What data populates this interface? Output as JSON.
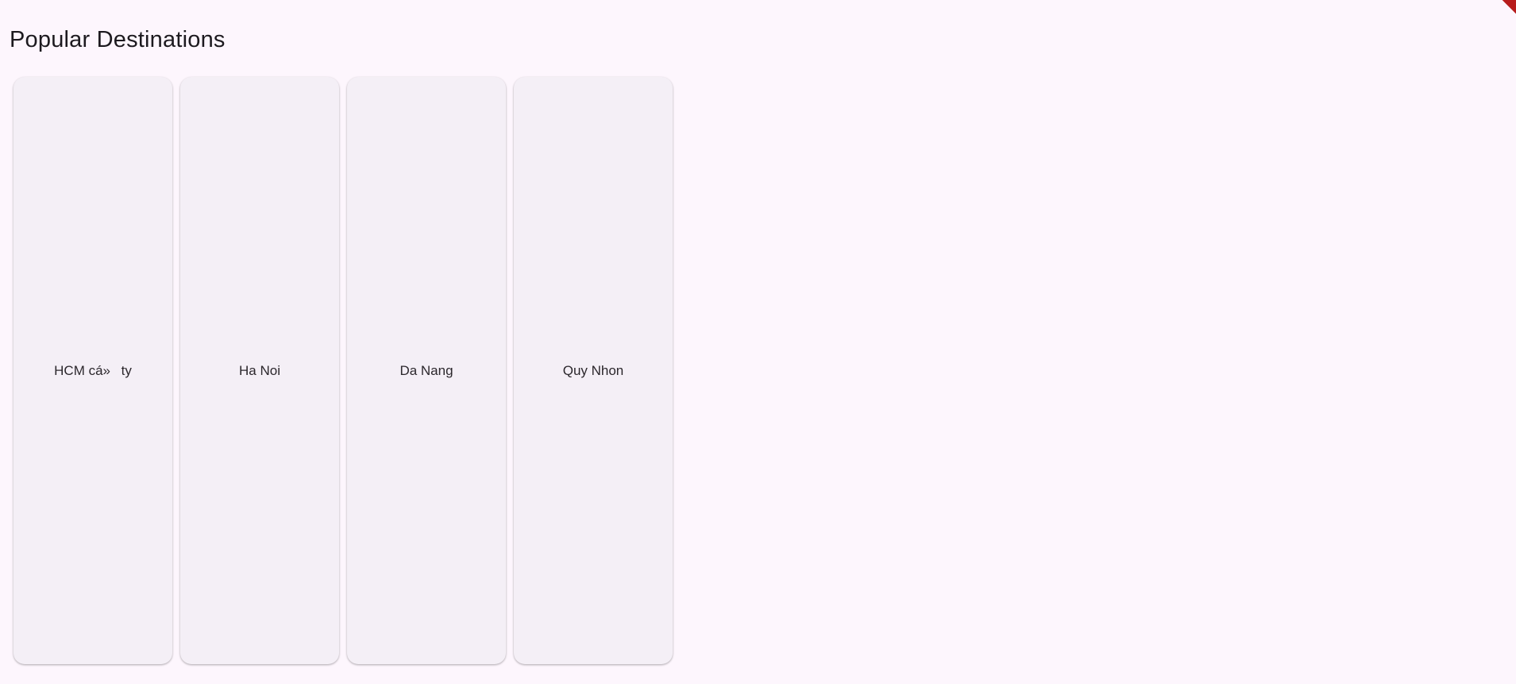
{
  "header": {
    "title": "Popular Destinations"
  },
  "destinations": [
    {
      "label": "HCM cá»ty"
    },
    {
      "label": "Ha Noi"
    },
    {
      "label": "Da Nang"
    },
    {
      "label": "Quy Nhon"
    }
  ],
  "colors": {
    "background": "#fdf6fd",
    "card": "#f4eff6",
    "text": "#1d1a1f",
    "debug_banner": "#b71c1c"
  }
}
